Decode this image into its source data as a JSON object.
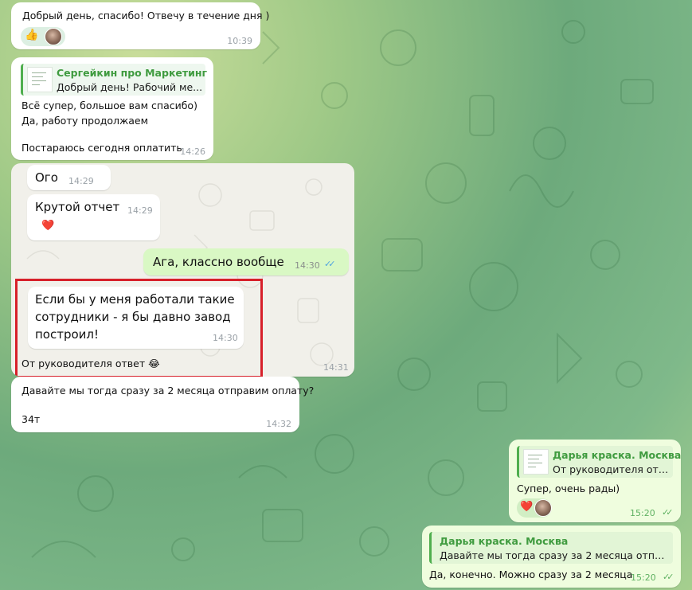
{
  "colors": {
    "incoming_bubble": "#ffffff",
    "outgoing_bubble": "#effdde",
    "accent_green": "#4fae4e",
    "highlight_red": "#d7202a",
    "read_check_blue": "#4fa3e0"
  },
  "messages": {
    "m1": {
      "text": "Добрый день, спасибо! Отвечу в течение дня )",
      "time": "10:39",
      "reaction_emoji": "👍"
    },
    "m2": {
      "reply_name": "Сергейкин про Маркетинг",
      "reply_text": "Добрый день! Рабочий ме...",
      "line1": "Всё супер, большое вам спасибо)",
      "line2": "Да, работу продолжаем",
      "line3": "Постараюсь сегодня оплатить",
      "time": "14:26"
    },
    "forward": {
      "r1_text": "Ого",
      "r1_time": "14:29",
      "r2_text": "Крутой отчет",
      "r2_time": "14:29",
      "r2_reaction": "❤️",
      "r3_text": "Ага, классно вообще",
      "r3_time": "14:30",
      "r4_line1": "Если бы у меня работали такие",
      "r4_line2": "сотрудники - я бы давно завод",
      "r4_line3": "построил!",
      "r4_time": "14:30",
      "caption": "От руководителя ответ 😂",
      "time": "14:31"
    },
    "m4": {
      "line1": "Давайте мы тогда сразу за 2 месяца отправим оплату?",
      "line2": "34т",
      "time": "14:32"
    },
    "m5": {
      "reply_name": "Дарья краска. Москва",
      "reply_text": "От руководителя отв...",
      "text": "Супер, очень рады)",
      "reaction_emoji": "❤️",
      "time": "15:20"
    },
    "m6": {
      "reply_name": "Дарья краска. Москва",
      "reply_text": "Давайте мы тогда сразу за 2 месяца отправи...",
      "text": "Да, конечно. Можно сразу за 2 месяца",
      "time": "15:20"
    }
  }
}
